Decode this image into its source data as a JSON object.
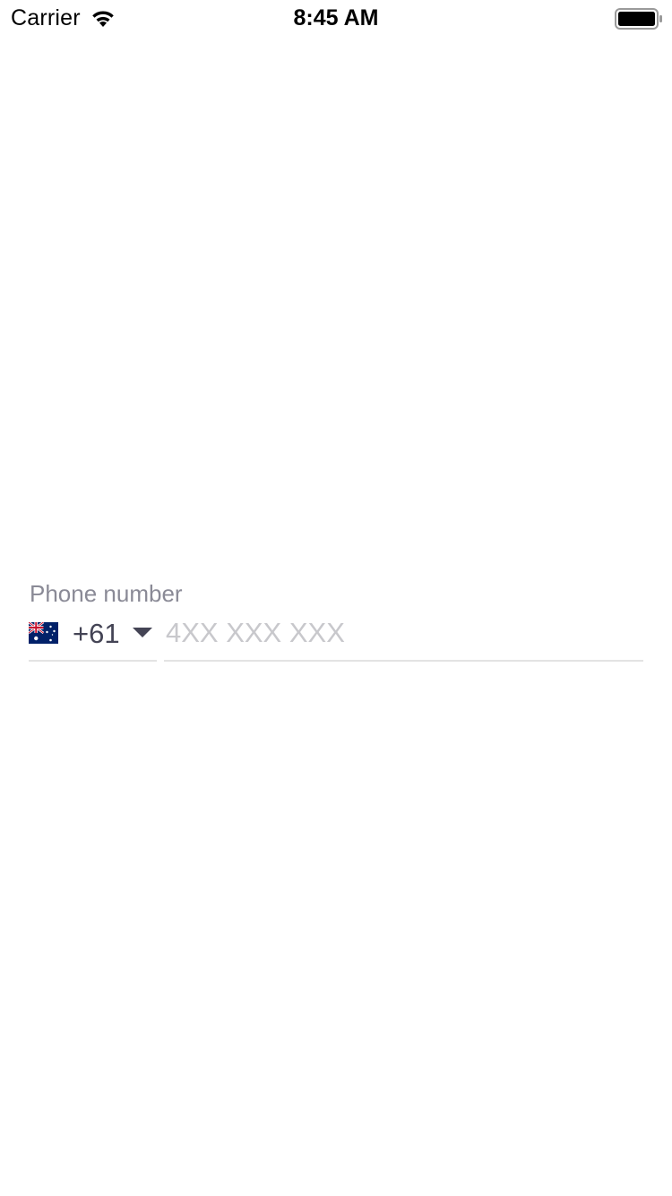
{
  "status_bar": {
    "carrier": "Carrier",
    "time": "8:45 AM",
    "icons": [
      "wifi-icon",
      "battery-icon"
    ]
  },
  "phone_field": {
    "label": "Phone number",
    "country_flag": "australia-flag-icon",
    "dial_code": "+61",
    "dropdown_icon": "chevron-down-icon",
    "value": "",
    "placeholder": "4XX XXX XXX"
  },
  "colors": {
    "label": "#8a8a96",
    "dial_code": "#444455",
    "placeholder": "#c8c8cc",
    "underline": "#e3e3e3",
    "background": "#ffffff"
  }
}
